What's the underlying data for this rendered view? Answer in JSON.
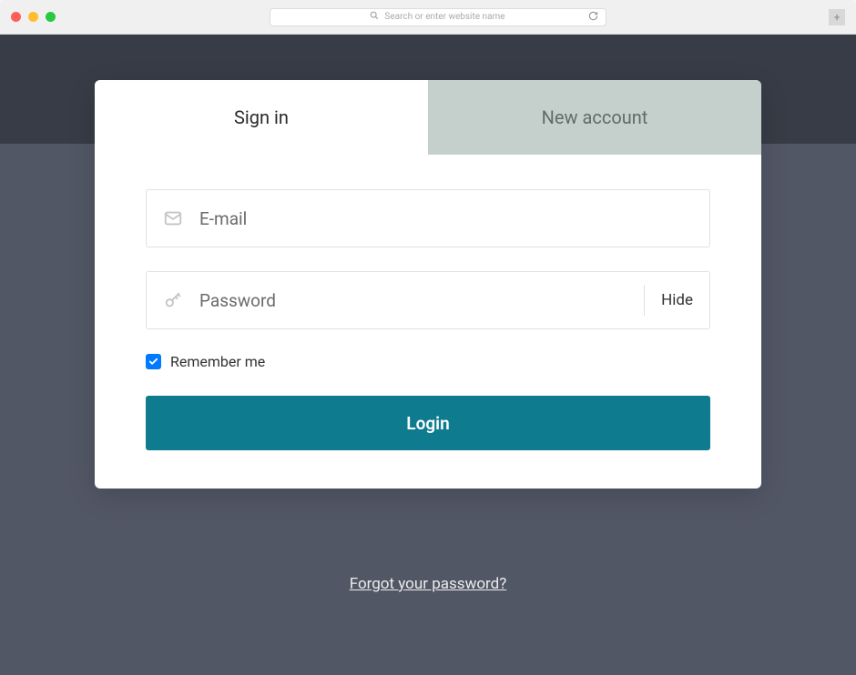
{
  "browser": {
    "address_placeholder": "Search or enter website name"
  },
  "tabs": {
    "signin": "Sign in",
    "newaccount": "New account"
  },
  "form": {
    "email_placeholder": "E-mail",
    "password_placeholder": "Password",
    "hide_toggle": "Hide",
    "remember_label": "Remember me",
    "remember_checked": true,
    "login_button": "Login"
  },
  "links": {
    "forgot": "Forgot your password?"
  },
  "colors": {
    "accent": "#0f7b8f",
    "checkbox": "#007aff",
    "page_bg": "#525766",
    "header_band": "#383c46",
    "inactive_tab": "#c5d0cd"
  }
}
